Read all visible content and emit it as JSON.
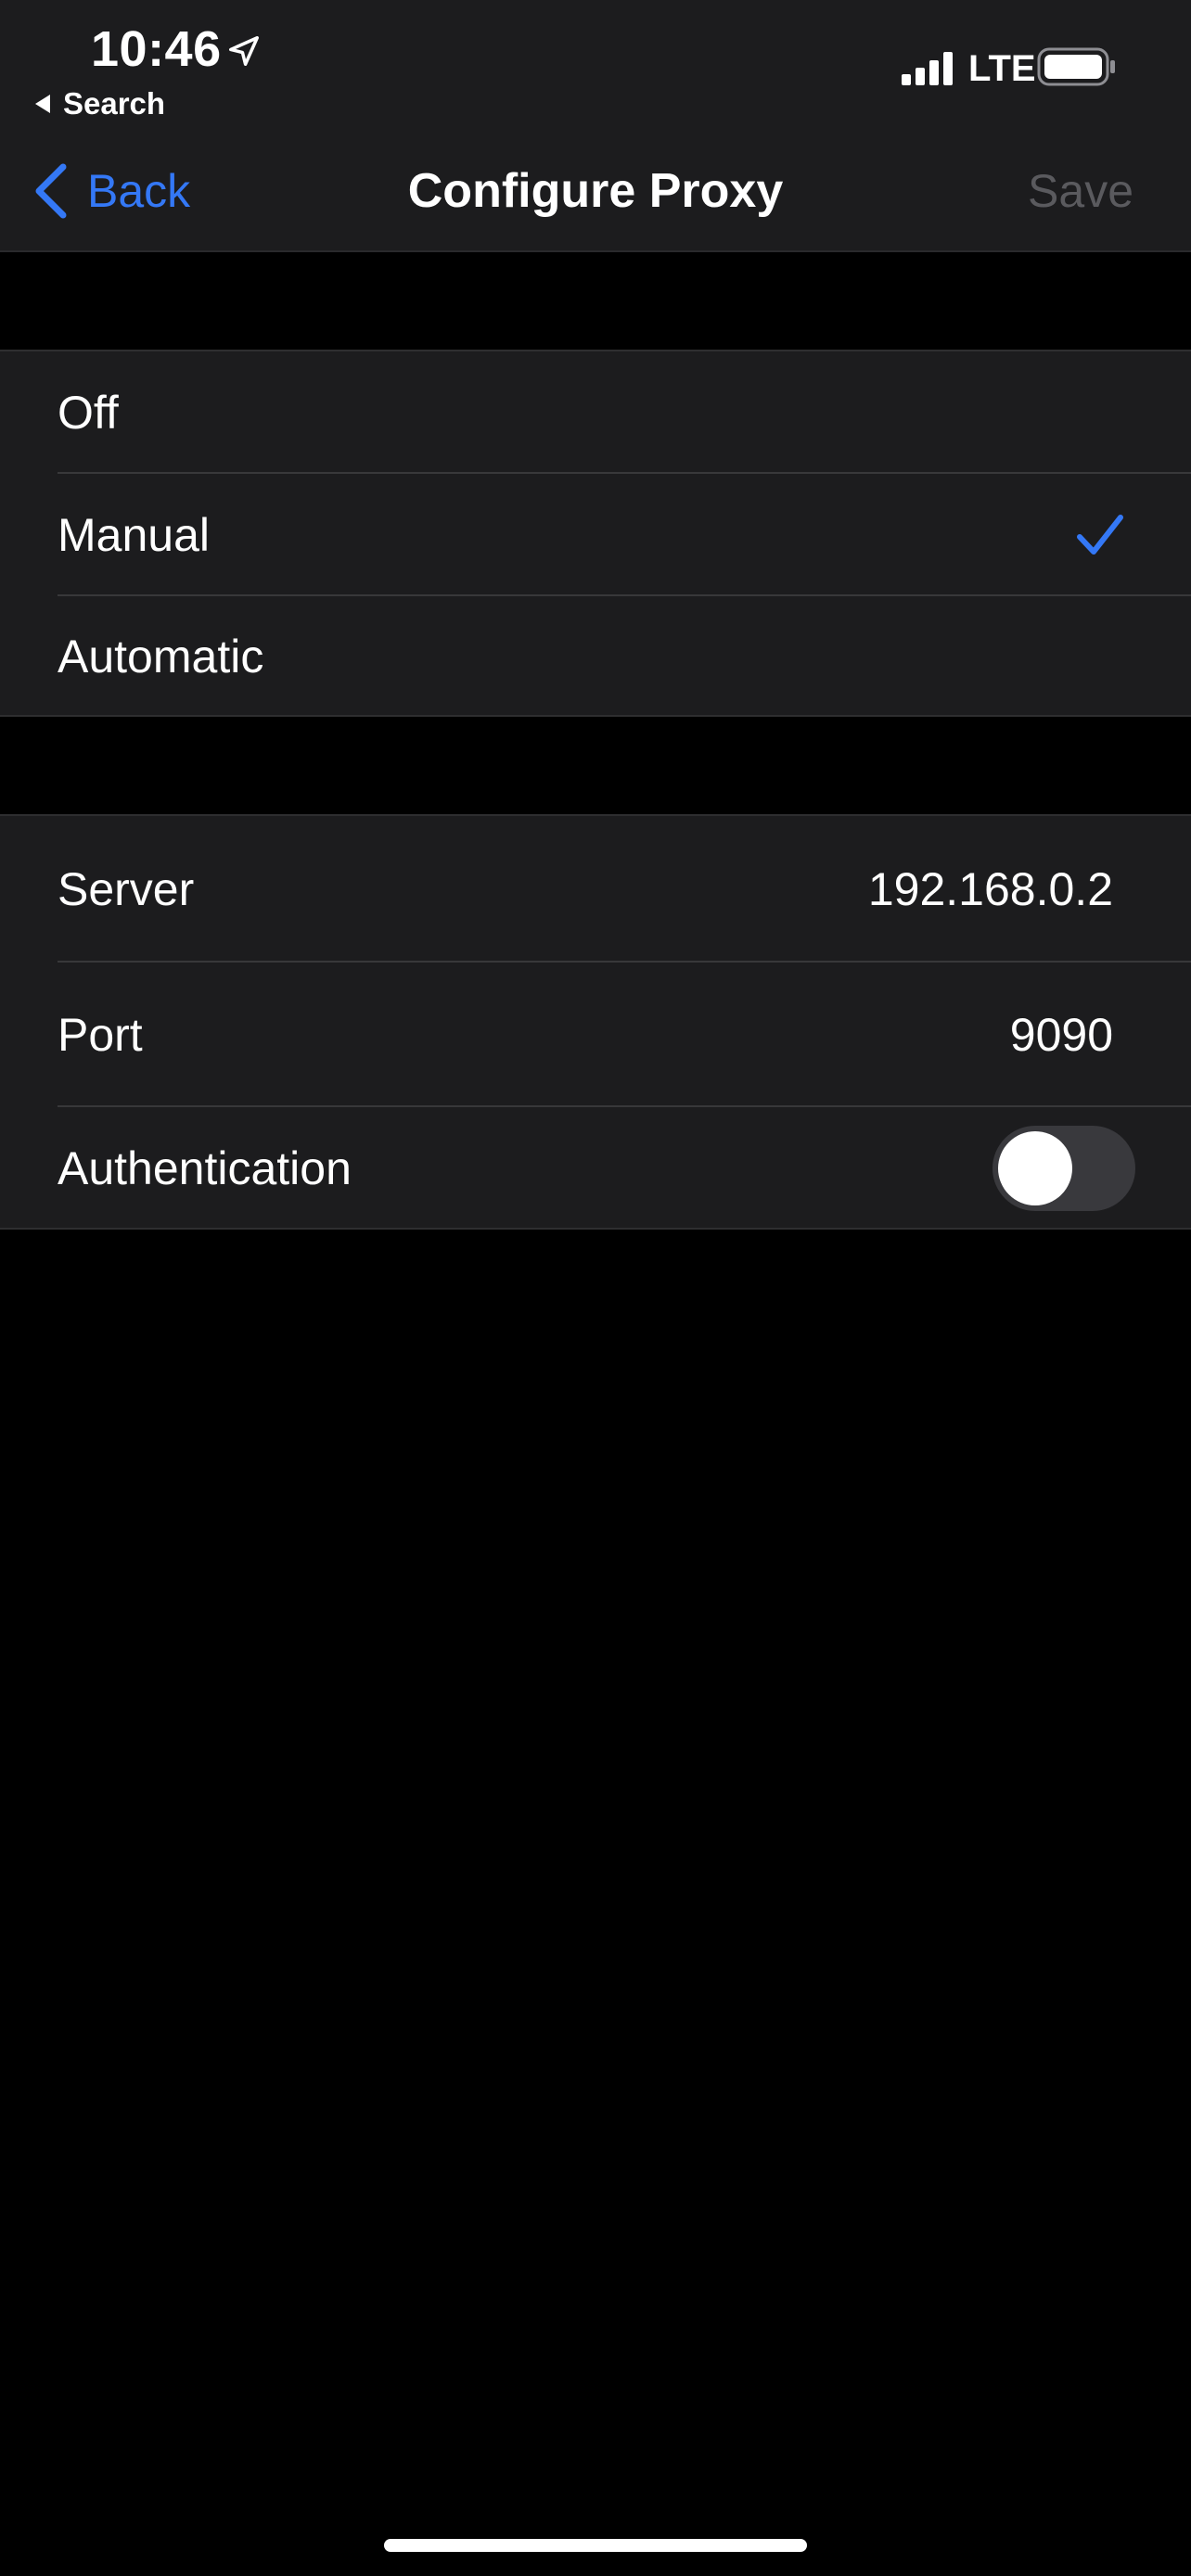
{
  "status_bar": {
    "time": "10:46",
    "network": "LTE",
    "back_app_label": "Search",
    "location_icon": "location-arrow-icon",
    "signal_icon": "cellular-signal-icon",
    "battery_icon": "battery-icon"
  },
  "nav": {
    "back_label": "Back",
    "title": "Configure Proxy",
    "save_label": "Save"
  },
  "proxy_modes": {
    "options": [
      {
        "label": "Off",
        "selected": false
      },
      {
        "label": "Manual",
        "selected": true
      },
      {
        "label": "Automatic",
        "selected": false
      }
    ]
  },
  "settings": {
    "server_label": "Server",
    "server_value": "192.168.0.2",
    "port_label": "Port",
    "port_value": "9090",
    "authentication_label": "Authentication",
    "authentication_enabled": false
  },
  "colors": {
    "accent": "#3478f6",
    "background": "#000000",
    "grouped_background": "#1c1c1e",
    "disabled_text": "#5a5a5e"
  }
}
